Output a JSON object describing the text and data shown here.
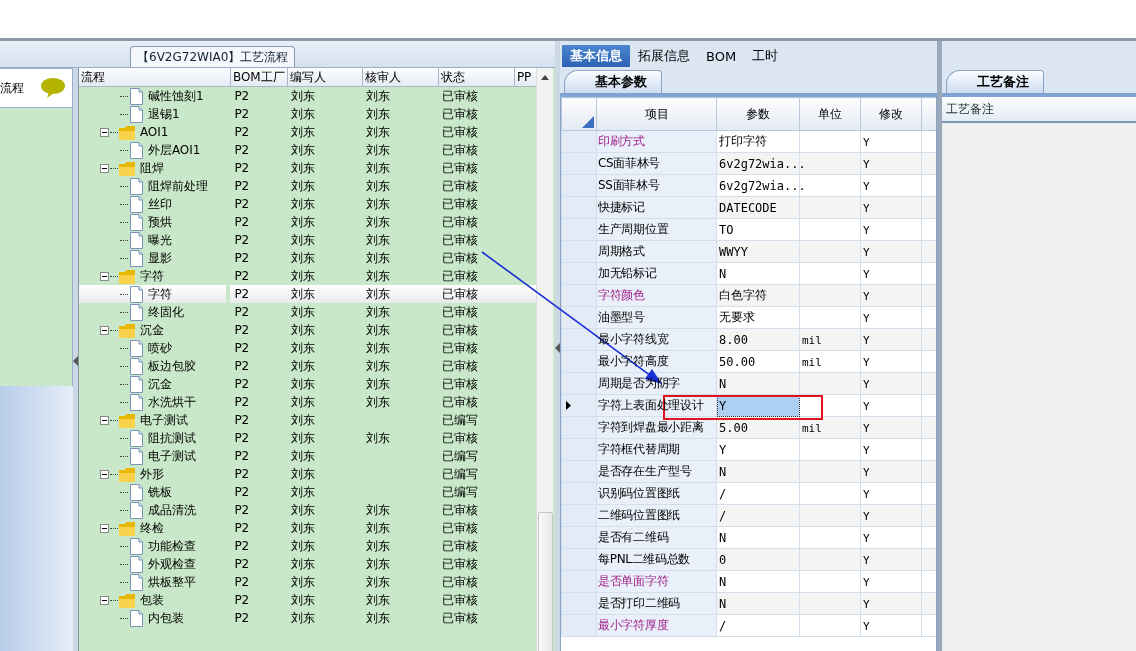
{
  "process_panel": {
    "title": "【6V2G72WIA0】工艺流程"
  },
  "side_panel": {
    "label": "流程"
  },
  "tree": {
    "columns": [
      "流程",
      "BOM工厂",
      "编写人",
      "核审人",
      "状态",
      "PP"
    ],
    "nodes": [
      {
        "children": [
          {
            "name": "碱性蚀刻1",
            "factory": "P2",
            "writer": "刘东",
            "reviewer": "刘东",
            "status": "已审核",
            "selected": false
          },
          {
            "name": "退锡1",
            "factory": "P2",
            "writer": "刘东",
            "reviewer": "刘东",
            "status": "已审核",
            "selected": false
          }
        ]
      },
      {
        "name": "AOI1",
        "factory": "P2",
        "writer": "刘东",
        "reviewer": "刘东",
        "status": "已审核",
        "selected": false,
        "expanded": true,
        "children": [
          {
            "name": "外层AOI1",
            "factory": "P2",
            "writer": "刘东",
            "reviewer": "刘东",
            "status": "已审核",
            "selected": false
          }
        ]
      },
      {
        "name": "阻焊",
        "factory": "P2",
        "writer": "刘东",
        "reviewer": "刘东",
        "status": "已审核",
        "selected": false,
        "expanded": true,
        "children": [
          {
            "name": "阻焊前处理",
            "factory": "P2",
            "writer": "刘东",
            "reviewer": "刘东",
            "status": "已审核",
            "selected": false
          },
          {
            "name": "丝印",
            "factory": "P2",
            "writer": "刘东",
            "reviewer": "刘东",
            "status": "已审核",
            "selected": false
          },
          {
            "name": "预烘",
            "factory": "P2",
            "writer": "刘东",
            "reviewer": "刘东",
            "status": "已审核",
            "selected": false
          },
          {
            "name": "曝光",
            "factory": "P2",
            "writer": "刘东",
            "reviewer": "刘东",
            "status": "已审核",
            "selected": false
          },
          {
            "name": "显影",
            "factory": "P2",
            "writer": "刘东",
            "reviewer": "刘东",
            "status": "已审核",
            "selected": false
          }
        ]
      },
      {
        "name": "字符",
        "factory": "P2",
        "writer": "刘东",
        "reviewer": "刘东",
        "status": "已审核",
        "selected": false,
        "expanded": true,
        "children": [
          {
            "name": "字符",
            "factory": "P2",
            "writer": "刘东",
            "reviewer": "刘东",
            "status": "已审核",
            "selected": true
          },
          {
            "name": "终固化",
            "factory": "P2",
            "writer": "刘东",
            "reviewer": "刘东",
            "status": "已审核",
            "selected": false
          }
        ]
      },
      {
        "name": "沉金",
        "factory": "P2",
        "writer": "刘东",
        "reviewer": "刘东",
        "status": "已审核",
        "selected": false,
        "expanded": true,
        "children": [
          {
            "name": "喷砂",
            "factory": "P2",
            "writer": "刘东",
            "reviewer": "刘东",
            "status": "已审核",
            "selected": false
          },
          {
            "name": "板边包胶",
            "factory": "P2",
            "writer": "刘东",
            "reviewer": "刘东",
            "status": "已审核",
            "selected": false
          },
          {
            "name": "沉金",
            "factory": "P2",
            "writer": "刘东",
            "reviewer": "刘东",
            "status": "已审核",
            "selected": false
          },
          {
            "name": "水洗烘干",
            "factory": "P2",
            "writer": "刘东",
            "reviewer": "刘东",
            "status": "已审核",
            "selected": false
          }
        ]
      },
      {
        "name": "电子测试",
        "factory": "P2",
        "writer": "刘东",
        "status": "已编写",
        "selected": false,
        "expanded": true,
        "children": [
          {
            "name": "阻抗测试",
            "factory": "P2",
            "writer": "刘东",
            "reviewer": "刘东",
            "status": "已审核",
            "selected": false
          },
          {
            "name": "电子测试",
            "factory": "P2",
            "writer": "刘东",
            "status": "已编写",
            "selected": false
          }
        ]
      },
      {
        "name": "外形",
        "factory": "P2",
        "writer": "刘东",
        "status": "已编写",
        "selected": false,
        "expanded": true,
        "children": [
          {
            "name": "铣板",
            "factory": "P2",
            "writer": "刘东",
            "status": "已编写",
            "selected": false
          },
          {
            "name": "成品清洗",
            "factory": "P2",
            "writer": "刘东",
            "reviewer": "刘东",
            "status": "已审核",
            "selected": false
          }
        ]
      },
      {
        "name": "终检",
        "factory": "P2",
        "writer": "刘东",
        "reviewer": "刘东",
        "status": "已审核",
        "selected": false,
        "expanded": true,
        "children": [
          {
            "name": "功能检查",
            "factory": "P2",
            "writer": "刘东",
            "reviewer": "刘东",
            "status": "已审核",
            "selected": false
          },
          {
            "name": "外观检查",
            "factory": "P2",
            "writer": "刘东",
            "reviewer": "刘东",
            "status": "已审核",
            "selected": false
          },
          {
            "name": "烘板整平",
            "factory": "P2",
            "writer": "刘东",
            "reviewer": "刘东",
            "status": "已审核",
            "selected": false
          }
        ]
      },
      {
        "name": "包装",
        "factory": "P2",
        "writer": "刘东",
        "reviewer": "刘东",
        "status": "已审核",
        "selected": false,
        "expanded": true,
        "children": [
          {
            "name": "内包装",
            "factory": "P2",
            "writer": "刘东",
            "reviewer": "刘东",
            "status": "已审核",
            "selected": false
          }
        ]
      }
    ]
  },
  "detail_tabs": [
    {
      "label": "基本信息",
      "selected": true
    },
    {
      "label": "拓展信息",
      "selected": false
    },
    {
      "label": "BOM",
      "selected": false
    },
    {
      "label": "工时",
      "selected": false
    }
  ],
  "sub_tab": {
    "label": "基本参数"
  },
  "params": {
    "columns": [
      "项目",
      "参数",
      "单位",
      "修改"
    ],
    "rows": [
      {
        "item": "印刷方式",
        "param": "打印字符",
        "modify": "Y",
        "required": true,
        "selected": false,
        "annotated": false
      },
      {
        "item": "CS面菲林号",
        "param": "6v2g72wia...",
        "modify": "Y",
        "required": false,
        "selected": false,
        "annotated": false
      },
      {
        "item": "SS面菲林号",
        "param": "6v2g72wia...",
        "modify": "Y",
        "required": false,
        "selected": false,
        "annotated": false
      },
      {
        "item": "快捷标记",
        "param": "DATECODE",
        "modify": "Y",
        "required": false,
        "selected": false,
        "annotated": false
      },
      {
        "item": "生产周期位置",
        "param": "TO",
        "modify": "Y",
        "required": false,
        "selected": false,
        "annotated": false
      },
      {
        "item": "周期格式",
        "param": "WWYY",
        "modify": "Y",
        "required": false,
        "selected": false,
        "annotated": false
      },
      {
        "item": "加无铅标记",
        "param": "N",
        "modify": "Y",
        "required": false,
        "selected": false,
        "annotated": false
      },
      {
        "item": "字符颜色",
        "param": "白色字符",
        "modify": "Y",
        "required": true,
        "selected": false,
        "annotated": false
      },
      {
        "item": "油墨型号",
        "param": "无要求",
        "modify": "Y",
        "required": false,
        "selected": false,
        "annotated": false
      },
      {
        "item": "最小字符线宽",
        "param": "8.00",
        "unit": "mil",
        "modify": "Y",
        "required": false,
        "selected": false,
        "annotated": false
      },
      {
        "item": "最小字符高度",
        "param": "50.00",
        "unit": "mil",
        "modify": "Y",
        "required": false,
        "selected": false,
        "annotated": false
      },
      {
        "item": "周期是否为阴字",
        "param": "N",
        "modify": "Y",
        "required": false,
        "selected": false,
        "annotated": false
      },
      {
        "item": "字符上表面处理设计",
        "param": "Y",
        "modify": "Y",
        "required": false,
        "selected": true,
        "annotated": true
      },
      {
        "item": "字符到焊盘最小距离",
        "param": "5.00",
        "unit": "mil",
        "modify": "Y",
        "required": false,
        "selected": false,
        "annotated": false
      },
      {
        "item": "字符框代替周期",
        "param": "Y",
        "modify": "Y",
        "required": false,
        "selected": false,
        "annotated": false
      },
      {
        "item": "是否存在生产型号",
        "param": "N",
        "modify": "Y",
        "required": false,
        "selected": false,
        "annotated": false
      },
      {
        "item": "识别码位置图纸",
        "param": "/",
        "modify": "Y",
        "required": false,
        "selected": false,
        "annotated": false
      },
      {
        "item": "二维码位置图纸",
        "param": "/",
        "modify": "Y",
        "required": false,
        "selected": false,
        "annotated": false
      },
      {
        "item": "是否有二维码",
        "param": "N",
        "modify": "Y",
        "required": false,
        "selected": false,
        "annotated": false
      },
      {
        "item": "每PNL二维码总数",
        "param": "0",
        "modify": "Y",
        "required": false,
        "selected": false,
        "annotated": false
      },
      {
        "item": "是否单面字符",
        "param": "N",
        "modify": "Y",
        "required": true,
        "selected": false,
        "annotated": false
      },
      {
        "item": "是否打印二维码",
        "param": "N",
        "modify": "Y",
        "required": false,
        "selected": false,
        "annotated": false
      },
      {
        "item": "最小字符厚度",
        "param": "/",
        "modify": "Y",
        "required": true,
        "selected": false,
        "annotated": false
      }
    ]
  },
  "notes_panel": {
    "tab": "工艺备注",
    "label": "工艺备注"
  }
}
